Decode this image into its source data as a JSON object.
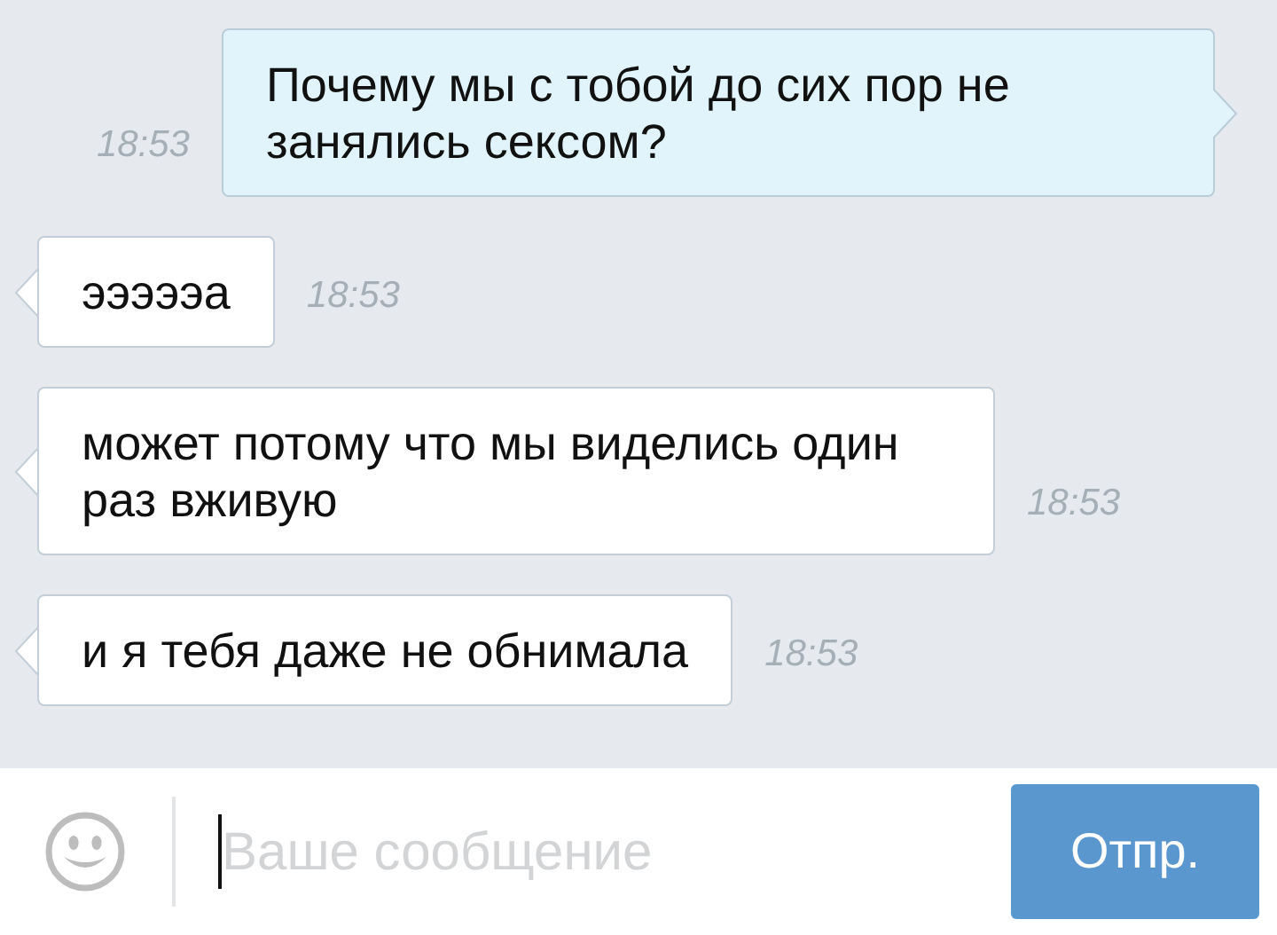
{
  "messages": [
    {
      "kind": "outgoing",
      "text": "Почему мы с тобой до сих пор не занялись сексом?",
      "time": "18:53"
    },
    {
      "kind": "incoming",
      "text": "эээээа",
      "time": "18:53"
    },
    {
      "kind": "incoming",
      "text": "может потому что мы виделись один раз вживую",
      "time": "18:53"
    },
    {
      "kind": "incoming",
      "text": "и я тебя даже не обнимала",
      "time": "18:53"
    }
  ],
  "composer": {
    "placeholder": "Ваше сообщение",
    "send_button": "Отпр."
  }
}
